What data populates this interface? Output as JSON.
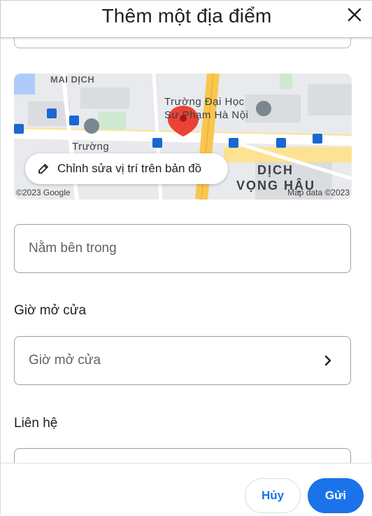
{
  "dialog": {
    "title": "Thêm một địa điểm"
  },
  "map": {
    "labels": {
      "mai_dich": "MAI DỊCH",
      "university_line1": "Trường Đại Học",
      "university_line2": "Sư Phạm Hà Nội",
      "school": "Trường",
      "dich_vong_hau_line1": "DỊCH",
      "dich_vong_hau_line2": "VỌNG HẬU"
    },
    "edit_location_label": "Chỉnh sửa vị trí trên bản đồ",
    "copyright_left": "©2023 Google",
    "copyright_right": "Map data ©2023"
  },
  "fields": {
    "located_within_placeholder": "Nằm bên trong",
    "hours_section_label": "Giờ mở cửa",
    "hours_placeholder": "Giờ mở cửa",
    "contact_section_label": "Liên hệ"
  },
  "footer": {
    "cancel_label": "Hủy",
    "submit_label": "Gửi"
  },
  "colors": {
    "accent": "#1a73e8",
    "pin": "#ea4335",
    "road_yellow": "#f9c74f",
    "transit": "#1967d2"
  }
}
